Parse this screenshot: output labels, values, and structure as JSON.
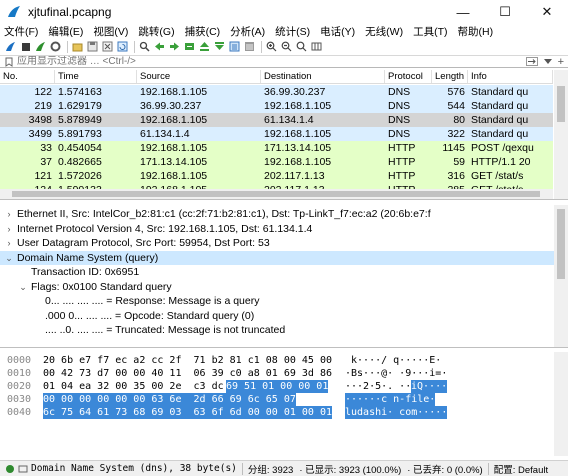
{
  "window": {
    "title": "xjtufinal.pcapng",
    "min_label": "—",
    "max_label": "☐",
    "close_label": "✕"
  },
  "menu": [
    "文件(F)",
    "编辑(E)",
    "视图(V)",
    "跳转(G)",
    "捕获(C)",
    "分析(A)",
    "统计(S)",
    "电话(Y)",
    "无线(W)",
    "工具(T)",
    "帮助(H)"
  ],
  "filter": {
    "placeholder": "应用显示过滤器 … <Ctrl-/>",
    "apply_arrow": "→",
    "plus": "+"
  },
  "packet_list": {
    "columns": [
      "No.",
      "Time",
      "Source",
      "Destination",
      "Protocol",
      "Length",
      "Info"
    ],
    "rows": [
      {
        "no": "122",
        "time": "1.574163",
        "src": "192.168.1.105",
        "dst": "36.99.30.237",
        "proto": "DNS",
        "len": "576",
        "info": "Standard qu",
        "style": "dns"
      },
      {
        "no": "219",
        "time": "1.629179",
        "src": "36.99.30.237",
        "dst": "192.168.1.105",
        "proto": "DNS",
        "len": "544",
        "info": "Standard qu",
        "style": "dns"
      },
      {
        "no": "3498",
        "time": "5.878949",
        "src": "192.168.1.105",
        "dst": "61.134.1.4",
        "proto": "DNS",
        "len": "80",
        "info": "Standard qu",
        "style": "sel"
      },
      {
        "no": "3499",
        "time": "5.891793",
        "src": "61.134.1.4",
        "dst": "192.168.1.105",
        "proto": "DNS",
        "len": "322",
        "info": "Standard qu",
        "style": "dns"
      },
      {
        "no": "33",
        "time": "0.454054",
        "src": "192.168.1.105",
        "dst": "171.13.14.105",
        "proto": "HTTP",
        "len": "1145",
        "info": "POST /qexqu",
        "style": "http"
      },
      {
        "no": "37",
        "time": "0.482665",
        "src": "171.13.14.105",
        "dst": "192.168.1.105",
        "proto": "HTTP",
        "len": "59",
        "info": "HTTP/1.1 20",
        "style": "http"
      },
      {
        "no": "121",
        "time": "1.572026",
        "src": "192.168.1.105",
        "dst": "202.117.1.13",
        "proto": "HTTP",
        "len": "316",
        "info": "GET /stat/s",
        "style": "http"
      },
      {
        "no": "124",
        "time": "1.590133",
        "src": "192.168.1.105",
        "dst": "202.117.1.13",
        "proto": "HTTP",
        "len": "285",
        "info": "GET /stat/s",
        "style": "http"
      }
    ]
  },
  "details": [
    {
      "arrow": "›",
      "indent": 0,
      "text": "Ethernet II, Src: IntelCor_b2:81:c1 (cc:2f:71:b2:81:c1), Dst: Tp-LinkT_f7:ec:a2 (20:6b:e7:f"
    },
    {
      "arrow": "›",
      "indent": 0,
      "text": "Internet Protocol Version 4, Src: 192.168.1.105, Dst: 61.134.1.4"
    },
    {
      "arrow": "›",
      "indent": 0,
      "text": "User Datagram Protocol, Src Port: 59954, Dst Port: 53"
    },
    {
      "arrow": "⌄",
      "indent": 0,
      "text": "Domain Name System (query)",
      "selected": true
    },
    {
      "arrow": "",
      "indent": 1,
      "text": "Transaction ID: 0x6951"
    },
    {
      "arrow": "⌄",
      "indent": 1,
      "text": "Flags: 0x0100 Standard query"
    },
    {
      "arrow": "",
      "indent": 2,
      "text": "0... .... .... .... = Response: Message is a query"
    },
    {
      "arrow": "",
      "indent": 2,
      "text": ".000 0... .... .... = Opcode: Standard query (0)"
    },
    {
      "arrow": "",
      "indent": 2,
      "text": ".... ..0. .... .... = Truncated: Message is not truncated"
    }
  ],
  "bytes": [
    {
      "off": "0000",
      "hex_a": "20 6b e7 f7 ec a2 cc 2f  71 b2 81 c1 08 00 45 00",
      "hex_b": "",
      "asc_a": " k····/ q·····E·",
      "asc_b": ""
    },
    {
      "off": "0010",
      "hex_a": "00 42 73 d7 00 00 40 11  06 39 c0 a8 01 69 3d 86",
      "hex_b": "",
      "asc_a": "·Bs···@· ·9···i=·",
      "asc_b": ""
    },
    {
      "off": "0020",
      "hex_a": "01 04 ea 32 00 35 00 2e  c3 dc ",
      "hex_b": "69 51 01 00 00 01",
      "asc_a": "···2·5·. ··",
      "asc_b": "iQ····"
    },
    {
      "off": "0030",
      "hex_a": "",
      "hex_b": "00 00 00 00 00 00 63 6e  2d 66 69 6c 65 07",
      "asc_a": "",
      "asc_b": "······c n-file·"
    },
    {
      "off": "0040",
      "hex_a": "",
      "hex_b": "6c 75 64 61 73 68 69 03  63 6f 6d 00 00 01 00 01",
      "asc_a": "",
      "asc_b": "ludashi· com·····"
    }
  ],
  "status": {
    "field": "Domain Name System (dns), 38 byte(s)",
    "packets": "分组: 3923",
    "displayed": "· 已显示: 3923 (100.0%)",
    "dropped": "· 已丢弃: 0 (0.0%)",
    "profile": "配置: Default"
  }
}
